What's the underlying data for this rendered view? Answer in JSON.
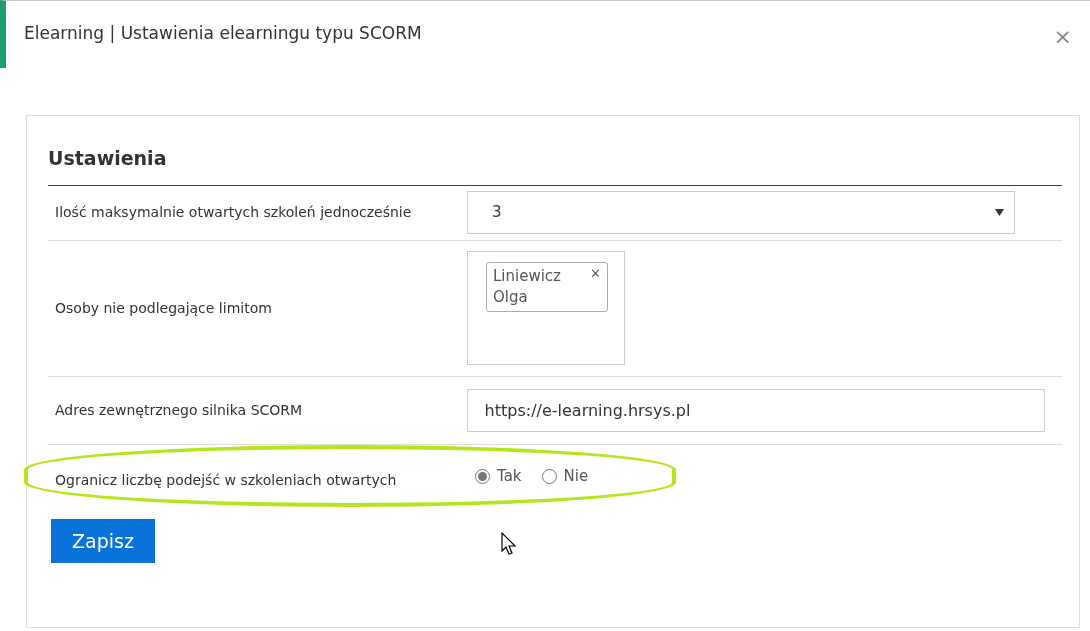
{
  "dialog": {
    "title": "Elearning | Ustawienia elearningu typu SCORM",
    "close": "×"
  },
  "panel": {
    "heading": "Ustawienia",
    "fields": [
      {
        "kind": "select",
        "label": "Ilość maksymalnie otwartych szkoleń jednocześnie",
        "value": "3"
      },
      {
        "kind": "tags",
        "label": "Osoby nie podlegające limitom",
        "tags": [
          {
            "text": "Liniewicz Olga",
            "remove": "✕"
          }
        ]
      },
      {
        "kind": "text",
        "label": "Adres zewnętrznego silnika SCORM",
        "value": "https://e-learning.hrsys.pl"
      },
      {
        "kind": "radio",
        "label": "Ogranicz liczbę podejść w szkoleniach otwartych",
        "highlighted": true,
        "options": [
          {
            "label": "Tak",
            "selected": true
          },
          {
            "label": "Nie",
            "selected": false
          }
        ]
      }
    ],
    "save": "Zapisz"
  }
}
